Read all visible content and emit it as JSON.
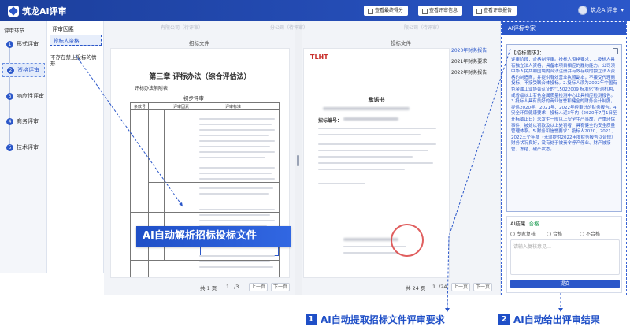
{
  "app": {
    "title": "筑龙AI评审"
  },
  "toolbar": {
    "btn1": "查看最终得分",
    "btn2": "查看评审信息",
    "btn3": "查看评审报告"
  },
  "user": {
    "name": "筑龙AI评审"
  },
  "sidebar": {
    "title": "评审环节",
    "steps": [
      {
        "num": "1",
        "label": "形式评审"
      },
      {
        "num": "2",
        "label": "资格评审"
      },
      {
        "num": "3",
        "label": "响应性评审"
      },
      {
        "num": "4",
        "label": "商务评审"
      },
      {
        "num": "5",
        "label": "技术评审"
      }
    ]
  },
  "tree": {
    "title": "评审因素",
    "items": [
      "投标人资格",
      "不存在禁止投标的情形"
    ]
  },
  "left_doc": {
    "tab": "有限公司（待评审）",
    "label": "招标文件",
    "chapter": "第三章   评标办法（综合评估法）",
    "subtitle": "评标办法前附表",
    "section": "初步评审",
    "table_headers": [
      "条款号",
      "评审因素",
      "评审标准"
    ],
    "page": {
      "total": "共 1 页",
      "current": "1",
      "of": "/3",
      "prev": "上一页",
      "next": "下一页"
    }
  },
  "right_doc": {
    "tab": "分公司（待评审）",
    "tab2": "限公司（待评审）",
    "label": "投标文件",
    "side_tags": [
      "2020年财务报告",
      "2021年财务要求",
      "2022年财务报告"
    ],
    "letter_title": "承诺书",
    "ref": "招标编号：",
    "page": {
      "total": "共 24 页",
      "current": "1",
      "of": "/24",
      "prev": "上一页",
      "next": "下一页"
    }
  },
  "callout": {
    "text": "AI自动解析招标投标文件"
  },
  "ai_panel": {
    "title": "AI评标专家",
    "card_title": "【招标要求】：",
    "card_text": "评审阶段：合格制评审。投标人资格要求：1.投标人具有独立法人资格，具备本项目相应的履约能力。公司须中华人民共和国境内合法注册并有效存续的独立法人资格的制造商，并提供有效营业执照副本，不接受代理商投标，不接受联合体投标。2.投标人须为2022年中国有色金属工业协会认证的“15022009 标准化”检测机构，或省级以上有色金属质量检测中心出具相应检测报告。3.投标人具有良好的商业信誉和健全的财务会计制度，提供2020年、2021年、2022年经审计的财务报告。4.安全环保健康要求：投标人近3年内（2020年7月1日至开标截止日）未发生一般以上安全生产事故，严重环保事件，被处以罚款及以上处罚者，具有健全的安全质量管理体系。5.财务和信誉要求：投标人2020、2021、2022三个年度（无须提供2022年度财务报告以合规）财务状况良好，没有处于被责令停产停业、财产被接管、冻结、破产状态。"
  },
  "result": {
    "title": "AI结果",
    "status": "合格",
    "options": [
      "专家复核",
      "合格",
      "不合格"
    ],
    "placeholder": "请输入复核意见…",
    "submit": "提交"
  },
  "bottom": {
    "label1_num": "1",
    "label1": "AI自动提取招标文件评审要求",
    "label2_num": "2",
    "label2": "AI自动给出评审结果"
  }
}
